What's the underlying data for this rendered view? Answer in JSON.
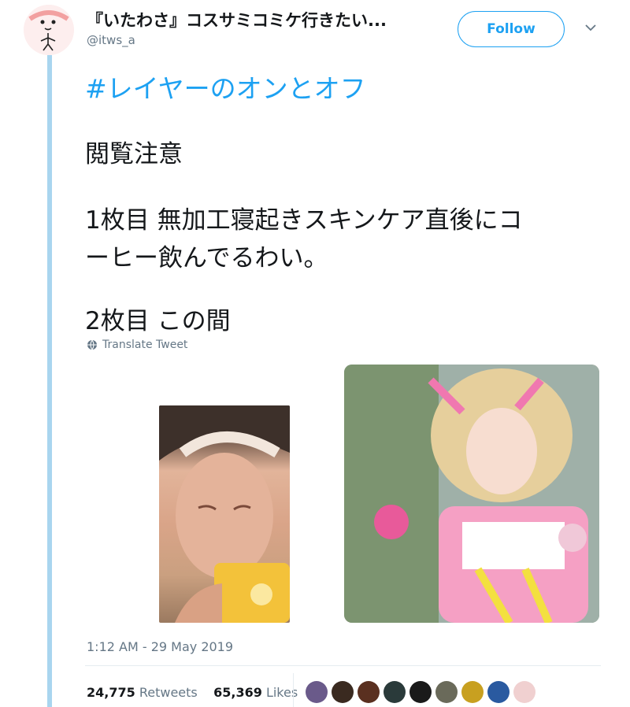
{
  "header": {
    "display_name": "『いたわさ』コスサミコミケ行きたい...",
    "handle": "@itws_a",
    "follow_label": "Follow"
  },
  "tweet": {
    "hashtag": "#レイヤーのオンとオフ",
    "lines": [
      "閲覧注意",
      "1枚目 無加工寝起きスキンケア直後にコ",
      "ーヒー飲んでるわい。",
      "2枚目 この間"
    ],
    "translate_label": "Translate Tweet",
    "timestamp": "1:12 AM - 29 May 2019"
  },
  "stats": {
    "retweets_count": "24,775",
    "retweets_label": "Retweets",
    "likes_count": "65,369",
    "likes_label": "Likes"
  },
  "colors": {
    "accent": "#1da1f2",
    "muted": "#657786",
    "thread_line": "#a9d5ef"
  },
  "icons": [
    "globe-icon",
    "chevron-down-icon"
  ],
  "liker_avatars": [
    "#6a5a8a",
    "#3a2a20",
    "#5a3020",
    "#2a3a3a",
    "#1a1a1a",
    "#6a6a5a",
    "#c8a020",
    "#2a5aa0",
    "#f0d0d0"
  ]
}
